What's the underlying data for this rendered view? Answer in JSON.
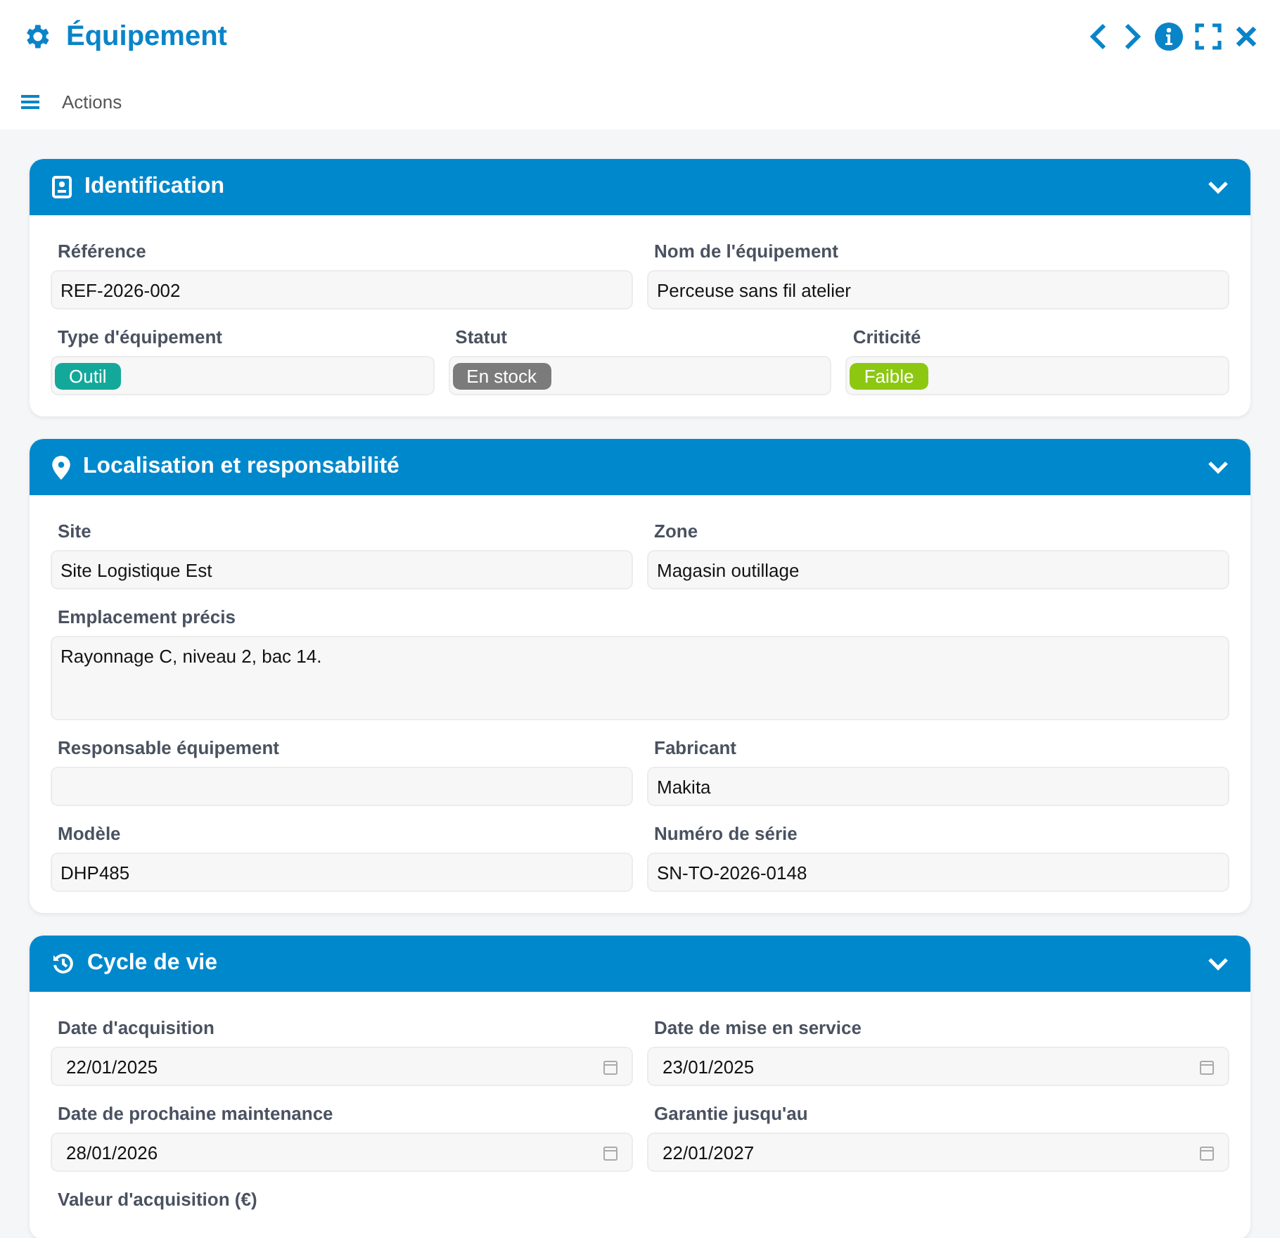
{
  "window": {
    "title": "Équipement"
  },
  "toolbar": {
    "menu_label": "Actions"
  },
  "sections": [
    {
      "title": "Identification",
      "expanded": true,
      "rows": [
        [
          {
            "label": "Référence",
            "kind": "text",
            "value": "REF-2026-002"
          },
          {
            "label": "Nom de l'équipement",
            "kind": "text",
            "value": "Perceuse sans fil atelier"
          }
        ],
        [
          {
            "label": "Type d'équipement",
            "kind": "badge",
            "value": "Outil",
            "color": "#14a89a"
          },
          {
            "label": "Statut",
            "kind": "badge",
            "value": "En stock",
            "color": "#7b7b7b"
          },
          {
            "label": "Criticité",
            "kind": "badge",
            "value": "Faible",
            "color": "#8cc812"
          }
        ]
      ]
    },
    {
      "title": "Localisation et responsabilité",
      "expanded": true,
      "rows": [
        [
          {
            "label": "Site",
            "kind": "text",
            "value": "Site Logistique Est"
          },
          {
            "label": "Zone",
            "kind": "text",
            "value": "Magasin outillage"
          }
        ],
        [
          {
            "label": "Emplacement précis",
            "kind": "textarea",
            "value": "Rayonnage C, niveau 2, bac 14."
          }
        ],
        [
          {
            "label": "Responsable équipement",
            "kind": "text"
          },
          {
            "label": "Fabricant",
            "kind": "text",
            "value": "Makita"
          }
        ],
        [
          {
            "label": "Modèle",
            "kind": "text",
            "value": "DHP485"
          },
          {
            "label": "Numéro de série",
            "kind": "text",
            "value": "SN-TO-2026-0148"
          }
        ]
      ]
    },
    {
      "title": "Cycle de vie",
      "expanded": true,
      "rows": [
        [
          {
            "label": "Date d'acquisition",
            "kind": "date",
            "value": "22/01/2025"
          },
          {
            "label": "Date de mise en service",
            "kind": "date",
            "value": "23/01/2025"
          }
        ],
        [
          {
            "label": "Date de prochaine maintenance",
            "kind": "date",
            "value": "28/01/2026"
          },
          {
            "label": "Garantie jusqu'au",
            "kind": "date",
            "value": "22/01/2027"
          }
        ],
        [
          {
            "label": "Valeur d'acquisition (€)",
            "kind": "label_only"
          }
        ]
      ]
    }
  ]
}
